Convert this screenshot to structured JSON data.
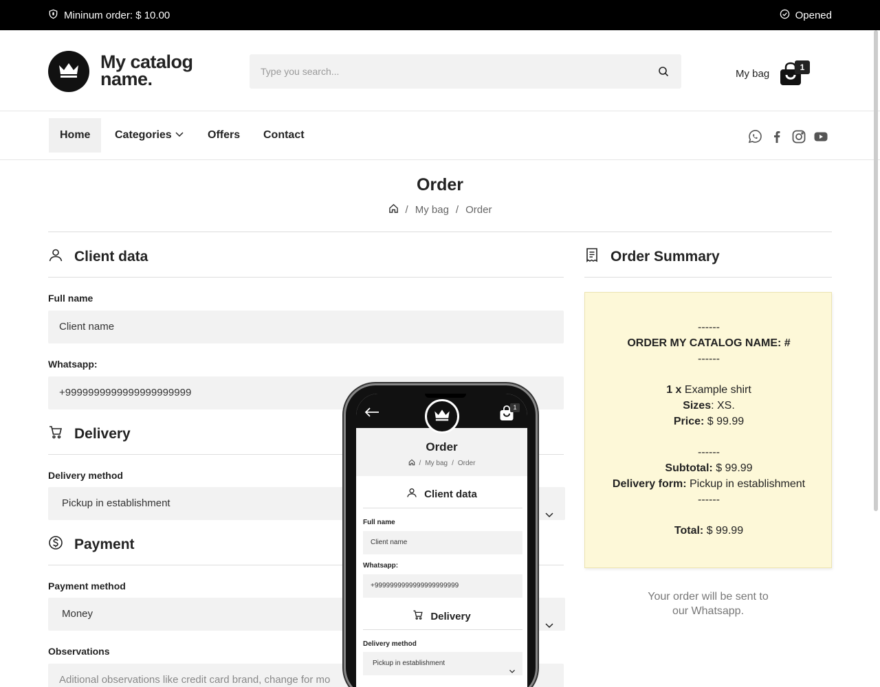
{
  "topbar": {
    "min_order": "Mininum order: $ 10.00",
    "status": "Opened"
  },
  "header": {
    "logo_line1": "My catalog",
    "logo_line2": "name.",
    "search_placeholder": "Type you search...",
    "bag_label": "My bag",
    "bag_count": "1"
  },
  "nav": {
    "items": [
      "Home",
      "Categories",
      "Offers",
      "Contact"
    ]
  },
  "page": {
    "title": "Order",
    "breadcrumb": [
      "My bag",
      "Order"
    ],
    "breadcrumb_sep": "/"
  },
  "client": {
    "title": "Client data",
    "full_name_label": "Full name",
    "full_name_value": "Client name",
    "whatsapp_label": "Whatsapp:",
    "whatsapp_value": "+9999999999999999999999"
  },
  "delivery": {
    "title": "Delivery",
    "method_label": "Delivery method",
    "method_value": "Pickup in establishment"
  },
  "payment": {
    "title": "Payment",
    "method_label": "Payment method",
    "method_value": "Money"
  },
  "observations": {
    "label": "Observations",
    "placeholder": "Aditional observations like credit card brand, change for mo"
  },
  "summary": {
    "title": "Order Summary",
    "dash": "------",
    "order_title": "ORDER MY CATALOG NAME: #",
    "item_qty": "1 x",
    "item_name": "Example shirt",
    "sizes_label": "Sizes",
    "sizes_value": ": XS.",
    "price_label": "Price:",
    "price_value": "$ 99.99",
    "subtotal_label": "Subtotal:",
    "subtotal_value": "$ 99.99",
    "delivery_label": "Delivery form:",
    "delivery_value": "Pickup in establishment",
    "total_label": "Total:",
    "total_value": "$ 99.99",
    "note_line1": "Your order will be sent to",
    "note_line2": "our Whatsapp."
  },
  "phone": {
    "bag_count": "1",
    "title": "Order",
    "breadcrumb": [
      "My bag",
      "Order"
    ],
    "client_title": "Client data",
    "full_name_label": "Full name",
    "full_name_value": "Client name",
    "whatsapp_label": "Whatsapp:",
    "whatsapp_value": "+9999999999999999999999",
    "delivery_title": "Delivery",
    "delivery_label": "Delivery method",
    "delivery_value": "Pickup in establishment"
  },
  "icons": {
    "shield": "shield-icon",
    "check": "check-circle-icon",
    "crown": "crown-icon",
    "search": "search-icon",
    "bag": "shopping-bag-icon",
    "chevron": "chevron-down-icon",
    "whatsapp": "whatsapp-icon",
    "facebook": "facebook-icon",
    "instagram": "instagram-icon",
    "youtube": "youtube-icon",
    "home": "home-icon",
    "user": "user-icon",
    "cart": "cart-icon",
    "dollar": "dollar-circle-icon",
    "receipt": "receipt-icon",
    "back": "arrow-left-icon"
  },
  "colors": {
    "topbar": "#000000",
    "receipt_bg": "#fdf8d8",
    "field_bg": "#f2f2f2"
  }
}
